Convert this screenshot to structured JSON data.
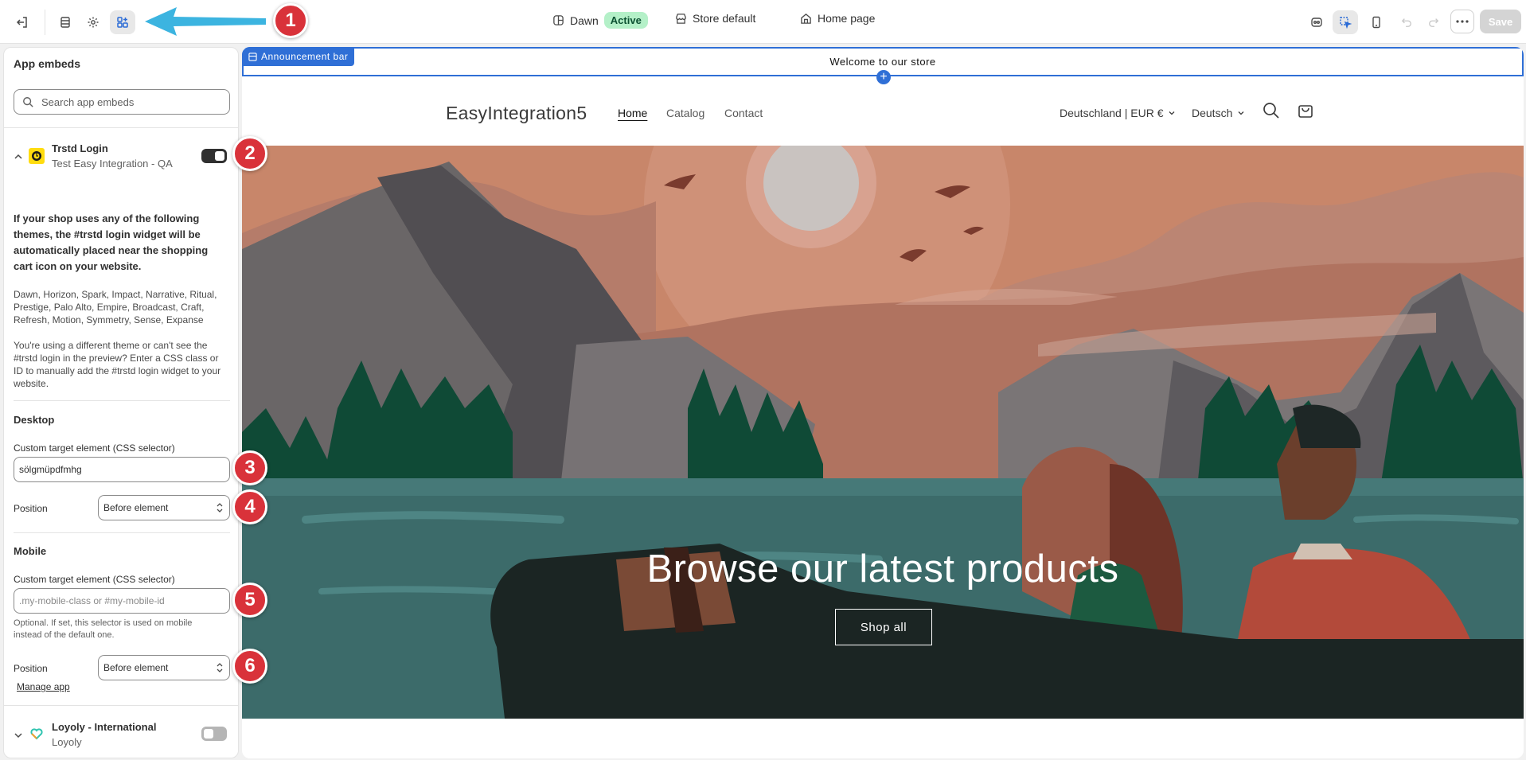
{
  "toolbar": {
    "theme_name": "Dawn",
    "theme_status": "Active",
    "store_label": "Store default",
    "page_label": "Home page",
    "save_label": "Save"
  },
  "markers": [
    "1",
    "2",
    "3",
    "4",
    "5",
    "6"
  ],
  "panel": {
    "title": "App embeds",
    "search_placeholder": "Search app embeds",
    "apps": [
      {
        "name": "Trstd Login",
        "subtitle": "Test Easy Integration - QA",
        "enabled": true,
        "intro": "If your shop uses any of the following themes, the #trstd login widget will be automatically placed near the shopping cart icon on your website.",
        "themes": "Dawn, Horizon, Spark, Impact, Narrative, Ritual, Prestige, Palo Alto, Empire, Broadcast, Craft, Refresh, Motion, Symmetry, Sense, Expanse",
        "hint": "You're using a different theme or can't see the #trstd login in the preview? Enter a CSS class or ID to manually add the #trstd login widget to your website.",
        "desktop": {
          "title": "Desktop",
          "field_label": "Custom target element (CSS selector)",
          "value": "sölgmüpdfmhg",
          "position_label": "Position",
          "position_value": "Before element"
        },
        "mobile": {
          "title": "Mobile",
          "field_label": "Custom target element (CSS selector)",
          "placeholder": ".my-mobile-class or #my-mobile-id",
          "help": "Optional. If set, this selector is used on mobile instead of the default one.",
          "position_label": "Position",
          "position_value": "Before element"
        },
        "manage_link": "Manage app"
      },
      {
        "name": "Loyoly - International",
        "subtitle": "Loyoly",
        "enabled": false
      }
    ]
  },
  "preview": {
    "announcement_tag": "Announcement bar",
    "announcement_text": "Welcome to our store",
    "store_name": "EasyIntegration5",
    "nav": [
      "Home",
      "Catalog",
      "Contact"
    ],
    "country": "Deutschland | EUR €",
    "language": "Deutsch",
    "hero_title": "Browse our latest products",
    "hero_button": "Shop all"
  },
  "colors": {
    "accent": "#2f6fd6",
    "marker": "#d9323a",
    "arrow": "#3cb4e0",
    "active_badge": "#b4f0c8"
  }
}
